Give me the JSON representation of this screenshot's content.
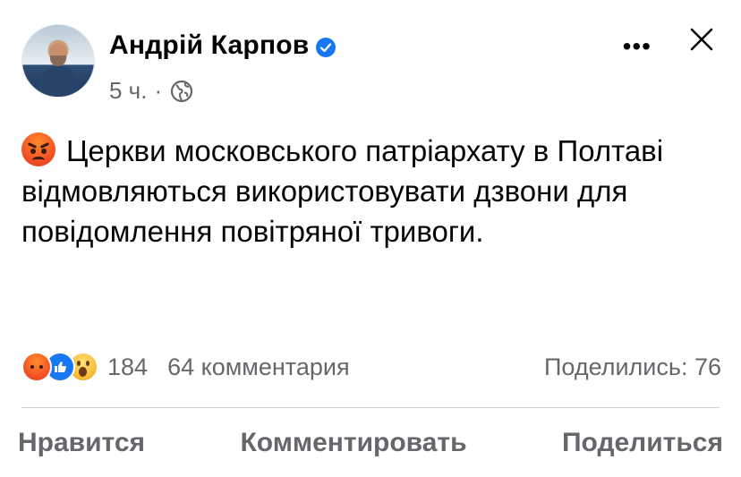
{
  "post": {
    "author": "Андрій Карпов",
    "verified": true,
    "time": "5 ч.",
    "separator": "·",
    "audience_icon": "globe-icon",
    "text": "Церкви московського патріархату в Полтаві відмовляються використовувати дзвони для повідомлення повітряної тривоги.",
    "leading_emoji": "angry-face-emoji"
  },
  "header": {
    "more_label": "•••",
    "close_icon": "close-icon"
  },
  "stats": {
    "reactions": [
      "angry-reaction",
      "like-reaction",
      "wow-reaction"
    ],
    "reaction_count": "184",
    "comments": "64 комментария",
    "shares": "Поделились: 76"
  },
  "actions": {
    "like": "Нравится",
    "comment": "Комментировать",
    "share": "Поделиться"
  },
  "colors": {
    "accent": "#1877f2",
    "secondary_text": "#65676b",
    "divider": "#ced0d4"
  }
}
